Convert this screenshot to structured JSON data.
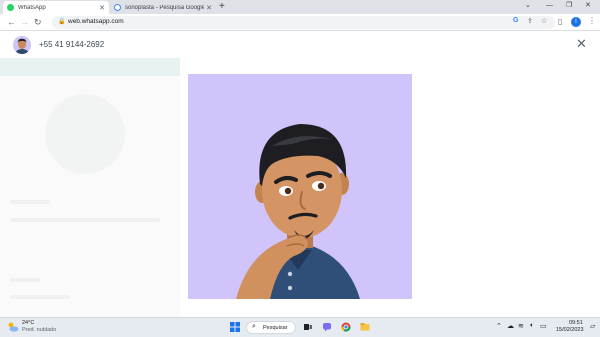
{
  "browser": {
    "tabs": [
      {
        "title": "WhatsApp",
        "favicon_color": "#25d366",
        "active": true
      },
      {
        "title": "sonoplasta - Pesquisa Google",
        "favicon_color": "#4285f4",
        "active": false
      }
    ],
    "url": "web.whatsapp.com",
    "profile_initial": "I"
  },
  "viewer": {
    "contact_phone": "+55 41 9144-2692"
  },
  "taskbar": {
    "temperature": "24°C",
    "condition": "Pred. nublado",
    "search_label": "Pesquisar",
    "time": "09:51",
    "date": "15/02/2023"
  },
  "colors": {
    "photo_background": "#d0c4fa",
    "whatsapp_green": "#25d366",
    "chrome_tabstrip": "#dee1e6"
  }
}
